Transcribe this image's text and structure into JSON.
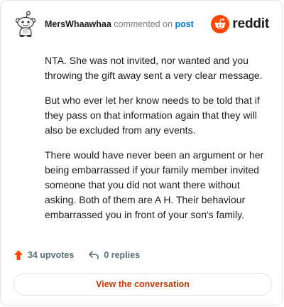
{
  "comment": {
    "username": "MersWhaawhaa",
    "action_text": "commented on",
    "link_text": "post",
    "paragraphs": [
      "NTA. She was not invited, nor wanted and you throwing the gift away sent a very clear message.",
      "But who ever let her know needs to be told that if they pass on that information again that they will also be excluded from any events.",
      "There would have never been an argument or her being embarrassed if your family member invited someone that you did not want there without asking. Both of them are A H. Their behaviour embarrassed you in front of your son's family."
    ]
  },
  "brand": {
    "wordmark": "reddit",
    "color": "#ff4500"
  },
  "actions": {
    "upvotes_label": "34 upvotes",
    "replies_label": "0 replies"
  },
  "cta": {
    "label": "View the conversation",
    "color": "#cc3700"
  },
  "icons": {
    "avatar": "snoo-avatar-icon",
    "brand": "reddit-logo-icon",
    "upvote": "upvote-arrow-icon",
    "reply": "reply-arrow-icon"
  }
}
